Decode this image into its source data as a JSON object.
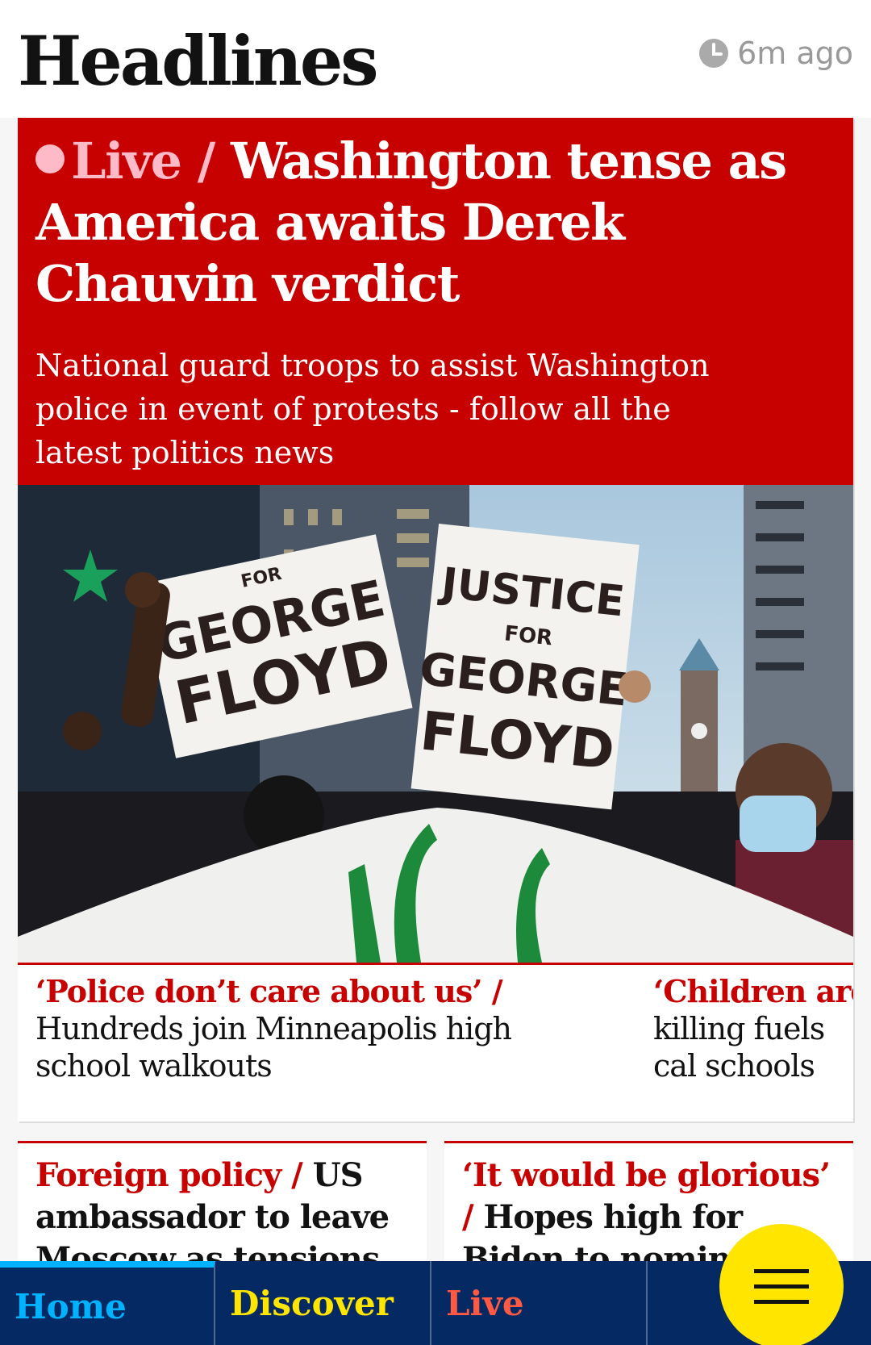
{
  "header": {
    "title": "Headlines",
    "updated": "6m ago",
    "updated_icon": "clock-icon"
  },
  "lead": {
    "kicker": "Live /",
    "headline": "Washington tense as America awaits Derek Chauvin verdict",
    "standfirst": "National guard troops to assist Washington police in event of protests - follow all the latest politics news",
    "image_alt": "Protesters holding Justice for George Floyd signs",
    "sign_left_line1": "FOR",
    "sign_left_line2": "GEORGE",
    "sign_left_line3": "FLOYD",
    "sign_right_line1": "JUSTICE",
    "sign_right_line2": "FOR",
    "sign_right_line3": "GEORGE",
    "sign_right_line4": "FLOYD",
    "sublinks": [
      {
        "kicker": "‘Police don’t care about us’ /",
        "text": " Hundreds join Minneapolis high school walkouts"
      },
      {
        "kicker": "‘Children are c",
        "text": "killing fuels cal schools"
      }
    ]
  },
  "cards": [
    {
      "kicker": "Foreign policy /",
      "text": " US ambassador to leave Moscow as tensions"
    },
    {
      "kicker": "‘It would be glorious’ /",
      "text": " Hopes high for Biden to nominate first"
    }
  ],
  "nav": {
    "home": "Home",
    "discover": "Discover",
    "live": "Live",
    "menu_icon": "hamburger-menu-icon"
  },
  "colors": {
    "news_red": "#c70000",
    "live_pink": "#ffbac8",
    "nav_blue": "#052962",
    "home_blue": "#00b2ff",
    "discover_yellow": "#ffe500",
    "live_orange": "#ff5943"
  }
}
